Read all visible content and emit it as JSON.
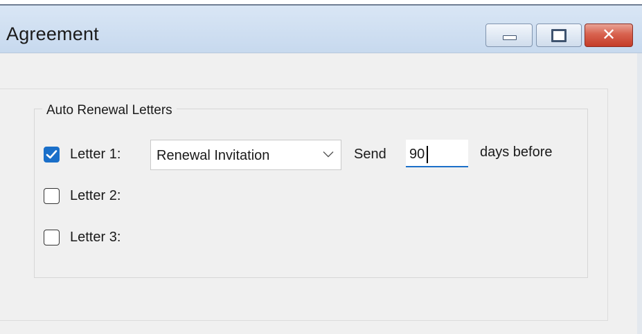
{
  "window": {
    "title": "Agreement",
    "controls": {
      "minimize": "minimize-icon",
      "maximize": "maximize-icon",
      "close": "close-icon"
    }
  },
  "group": {
    "legend": "Auto Renewal Letters",
    "letters": [
      {
        "label": "Letter 1:",
        "checked": true
      },
      {
        "label": "Letter 2:",
        "checked": false
      },
      {
        "label": "Letter 3:",
        "checked": false
      }
    ],
    "letter1_template": "Renewal Invitation",
    "send_label": "Send",
    "days_value": "90",
    "days_suffix": "days before"
  },
  "colors": {
    "accent": "#1a6fc9",
    "titlebar": "#d3e2f3",
    "close": "#c9432e"
  }
}
